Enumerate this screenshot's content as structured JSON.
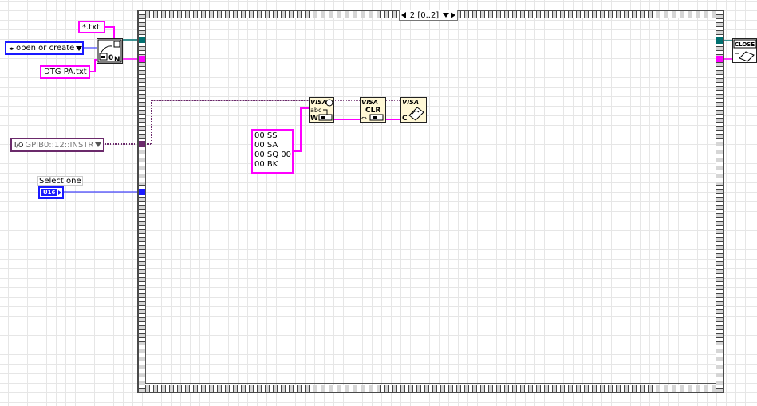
{
  "sequence": {
    "selector_label": "2 [0..2]"
  },
  "constants": {
    "file_pattern": "*.txt",
    "operation": "open or create",
    "file_name": "DTG PA.txt",
    "visa_resource": "GPIB0::12::INSTR",
    "select_label": "Select one",
    "select_type": "U16",
    "command_lines": [
      "00 SS",
      "00 SA",
      "00 SQ 00",
      "00 BK"
    ]
  },
  "vis": {
    "open_file": {
      "glyph": "0",
      "letter": "N"
    },
    "visa_write": {
      "title": "VISA",
      "sub": "abc",
      "letter": "W"
    },
    "visa_clear": {
      "title": "VISA",
      "sub": "CLR"
    },
    "visa_close": {
      "title": "VISA",
      "letter": "C"
    },
    "close_file": {
      "label": "CLOSE"
    }
  },
  "colors": {
    "string_wire": "#ff00ff",
    "visa_wire": "#6b2a6b",
    "refnum_wire": "#007070",
    "numeric_wire": "#1a1aff"
  }
}
